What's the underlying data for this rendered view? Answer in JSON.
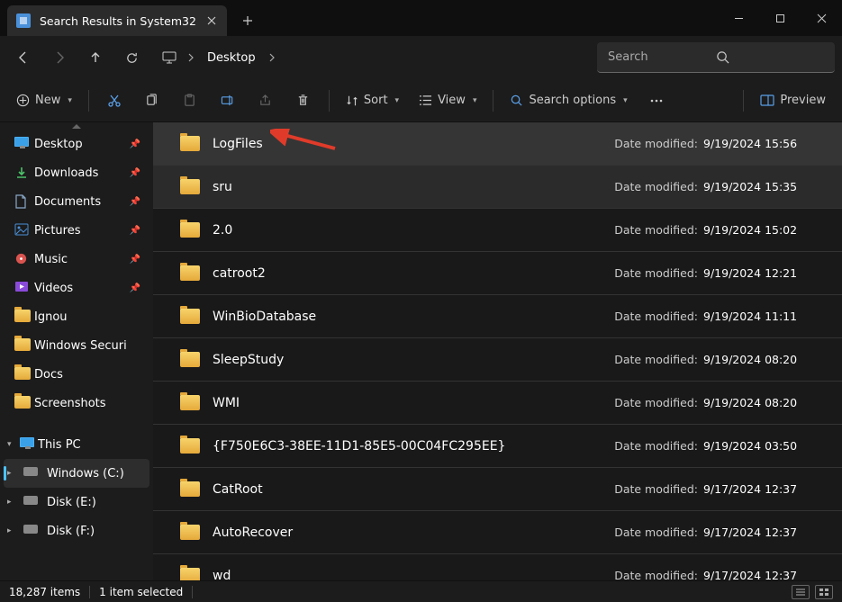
{
  "tab": {
    "title": "Search Results in System32"
  },
  "breadcrumb": {
    "segment": "Desktop"
  },
  "search": {
    "placeholder": "Search"
  },
  "toolbar": {
    "new": "New",
    "sort": "Sort",
    "view": "View",
    "search_options": "Search options",
    "preview": "Preview"
  },
  "sidebar": {
    "quick": [
      {
        "label": "Desktop",
        "icon": "desktop"
      },
      {
        "label": "Downloads",
        "icon": "download"
      },
      {
        "label": "Documents",
        "icon": "document"
      },
      {
        "label": "Pictures",
        "icon": "pictures"
      },
      {
        "label": "Music",
        "icon": "music"
      },
      {
        "label": "Videos",
        "icon": "videos"
      },
      {
        "label": "Ignou",
        "icon": "folder"
      },
      {
        "label": "Windows Securi",
        "icon": "folder"
      },
      {
        "label": "Docs",
        "icon": "folder"
      },
      {
        "label": "Screenshots",
        "icon": "folder"
      }
    ],
    "thispc": {
      "label": "This PC"
    },
    "drives": [
      {
        "label": "Windows (C:)"
      },
      {
        "label": "Disk (E:)"
      },
      {
        "label": "Disk (F:)"
      }
    ]
  },
  "date_modified_label": "Date modified:",
  "files": [
    {
      "name": "LogFiles",
      "date": "9/19/2024 15:56",
      "selected": true
    },
    {
      "name": "sru",
      "date": "9/19/2024 15:35",
      "hover": true
    },
    {
      "name": "2.0",
      "date": "9/19/2024 15:02"
    },
    {
      "name": "catroot2",
      "date": "9/19/2024 12:21"
    },
    {
      "name": "WinBioDatabase",
      "date": "9/19/2024 11:11"
    },
    {
      "name": "SleepStudy",
      "date": "9/19/2024 08:20"
    },
    {
      "name": "WMI",
      "date": "9/19/2024 08:20"
    },
    {
      "name": "{F750E6C3-38EE-11D1-85E5-00C04FC295EE}",
      "date": "9/19/2024 03:50"
    },
    {
      "name": "CatRoot",
      "date": "9/17/2024 12:37"
    },
    {
      "name": "AutoRecover",
      "date": "9/17/2024 12:37"
    },
    {
      "name": "wd",
      "date": "9/17/2024 12:37"
    }
  ],
  "status": {
    "count": "18,287 items",
    "selected": "1 item selected"
  }
}
